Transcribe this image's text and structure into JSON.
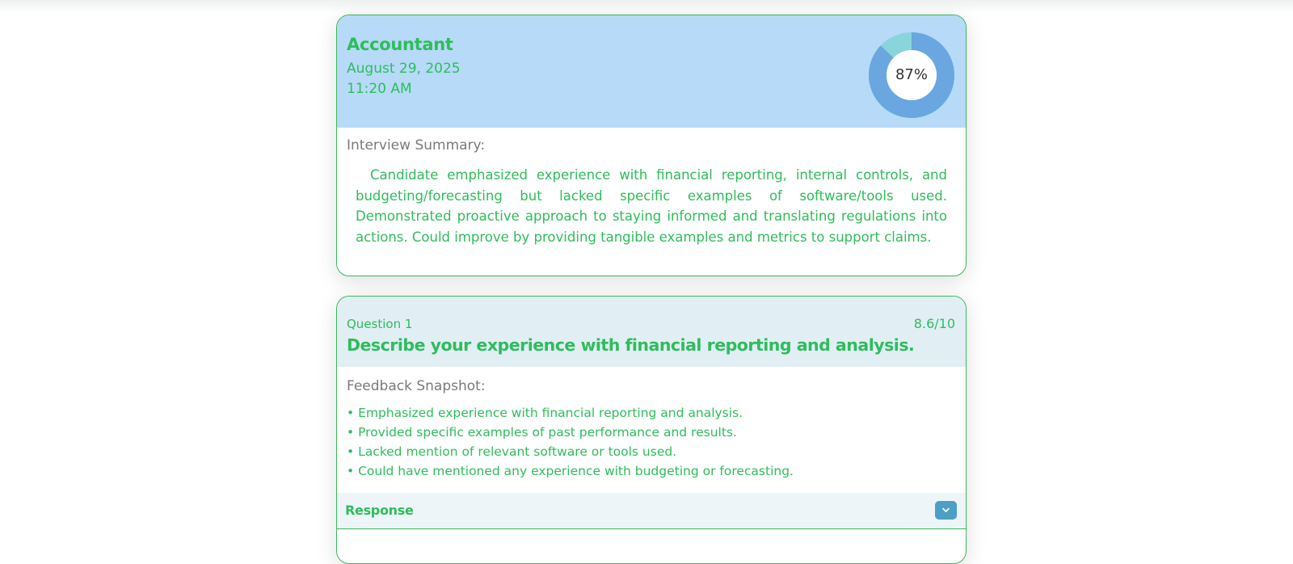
{
  "interview": {
    "job_title": "Accountant",
    "date": "August 29, 2025",
    "time": "11:20 AM",
    "score_percent": 87,
    "score_label": "87%",
    "summary_label": "Interview Summary:",
    "summary_text": "Candidate emphasized experience with financial reporting, internal controls, and budgeting/forecasting but lacked specific examples of software/tools used. Demonstrated proactive approach to staying informed and translating regulations into actions. Could improve by providing tangible examples and metrics to support claims."
  },
  "question": {
    "number_label": "Question 1",
    "score": "8.6/10",
    "title": "Describe your experience with financial reporting and analysis.",
    "feedback_label": "Feedback Snapshot:",
    "feedback": [
      "• Emphasized experience with financial reporting and analysis.",
      "• Provided specific examples of past performance and results.",
      "• Lacked mention of relevant software or tools used.",
      "• Could have mentioned any experience with budgeting or forecasting."
    ],
    "response_label": "Response",
    "response_icon": "chevron-down-icon"
  },
  "colors": {
    "accent_green": "#2ebd5b",
    "header_blue": "#b6daf8",
    "donut_fill": "#6aa6e0",
    "donut_remaining": "#8ad4dc",
    "question_header": "#e1eff5",
    "toggle_button": "#4d9fc4"
  }
}
